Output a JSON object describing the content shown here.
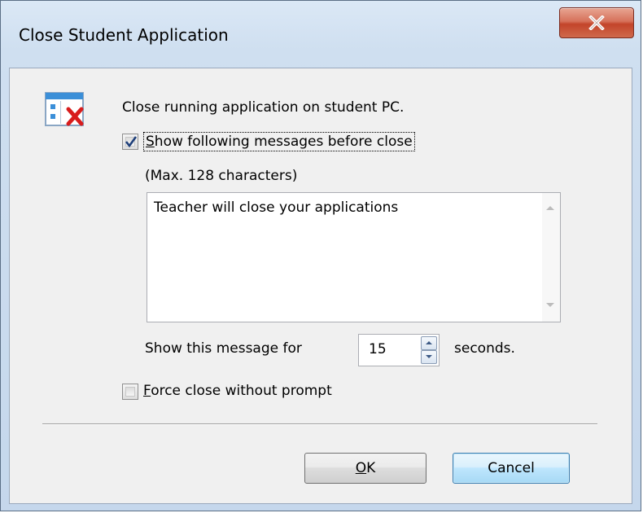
{
  "window": {
    "title": "Close Student Application",
    "close_button_label": "X"
  },
  "dialog": {
    "heading": "Close running application on student PC.",
    "show_messages": {
      "label_pre": "",
      "label_accel": "S",
      "label_post": "how following messages before close",
      "checked": true
    },
    "max_note": "(Max. 128 characters)",
    "message_text": "Teacher will close your applications",
    "show_for_label": "Show this message for",
    "seconds_value": "15",
    "seconds_label": "seconds.",
    "force_close": {
      "label_accel": "F",
      "label_post": "orce close without prompt",
      "checked": false
    }
  },
  "buttons": {
    "ok_accel": "O",
    "ok_post": "K",
    "cancel_label": "Cancel"
  },
  "colors": {
    "close_button": "#c3442a",
    "check_mark": "#1e3f7a",
    "icon_x": "#d81c1c",
    "icon_blue": "#3b8fd8"
  }
}
